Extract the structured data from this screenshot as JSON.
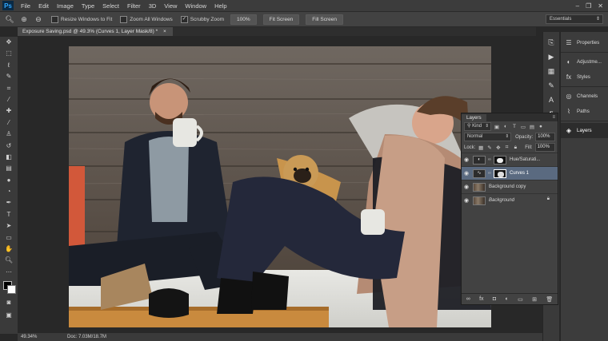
{
  "app": {
    "logo": "Ps"
  },
  "menu": [
    "File",
    "Edit",
    "Image",
    "Type",
    "Select",
    "Filter",
    "3D",
    "View",
    "Window",
    "Help"
  ],
  "window_controls": [
    "–",
    "❐",
    "✕"
  ],
  "options": {
    "resize_windows": "Resize Windows to Fit",
    "zoom_all": "Zoom All Windows",
    "scrubby_zoom": "Scrubby Zoom",
    "btn_100": "100%",
    "fit_screen": "Fit Screen",
    "fill_screen": "Fill Screen",
    "workspace": "Essentials"
  },
  "document": {
    "tab_title": "Exposure Saving.psd @ 49.3% (Curves 1, Layer Mask/8) *",
    "tab_close": "×"
  },
  "status": {
    "zoom": "49.34%",
    "docsize": "Doc: 7.03M/18.7M"
  },
  "right_panel": [
    {
      "label": "Properties",
      "icon": "properties-icon"
    },
    {
      "label": "Adjustme...",
      "icon": "adjustments-icon"
    },
    {
      "label": "Styles",
      "icon": "styles-icon"
    },
    {
      "label": "Channels",
      "icon": "channels-icon"
    },
    {
      "label": "Paths",
      "icon": "paths-icon"
    },
    {
      "label": "Layers",
      "icon": "layers-icon"
    }
  ],
  "layers_panel": {
    "tab": "Layers",
    "filter": "Kind",
    "blend_mode": "Normal",
    "opacity_label": "Opacity:",
    "opacity": "100%",
    "lock_label": "Lock:",
    "fill_label": "Fill:",
    "fill": "100%",
    "layers": [
      {
        "name": "Hue/Saturati...",
        "type": "adjustment"
      },
      {
        "name": "Curves 1",
        "type": "adjustment",
        "selected": true
      },
      {
        "name": "Background copy",
        "type": "pixel"
      },
      {
        "name": "Background",
        "type": "pixel",
        "locked": true
      }
    ]
  },
  "colors": {
    "accent": "#31a8ff",
    "selected_layer": "#5a6a80",
    "panel": "#424242"
  }
}
